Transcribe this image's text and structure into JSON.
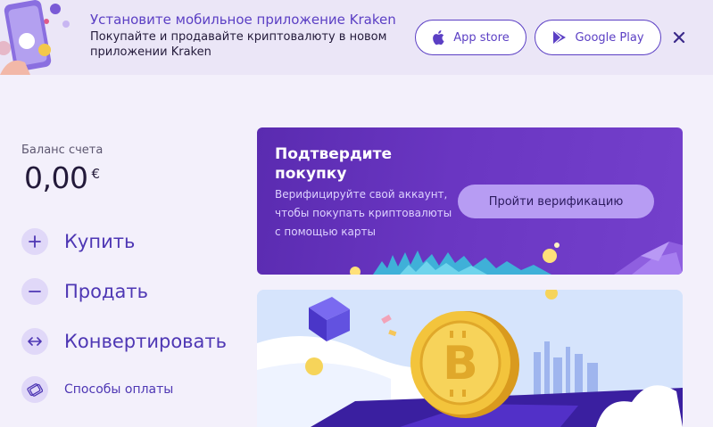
{
  "banner": {
    "title": "Установите мобильное приложение Kraken",
    "subtitle": "Покупайте и продавайте криптовалюту в новом приложении Kraken",
    "app_store_label": "App store",
    "google_play_label": "Google Play"
  },
  "balance": {
    "label": "Баланс счета",
    "value": "0,00",
    "currency": "€"
  },
  "actions": {
    "buy": "Купить",
    "sell": "Продать",
    "convert": "Конвертировать",
    "payment_methods": "Способы оплаты"
  },
  "verify": {
    "title": "Подтвердите покупку",
    "text": "Верифицируйте свой аккаунт, чтобы покупать криптовалюты с помощью карты",
    "button": "Пройти верификацию"
  },
  "colors": {
    "accent": "#5b3fc4",
    "card": "#6a36c2",
    "button": "#b79cf3"
  }
}
